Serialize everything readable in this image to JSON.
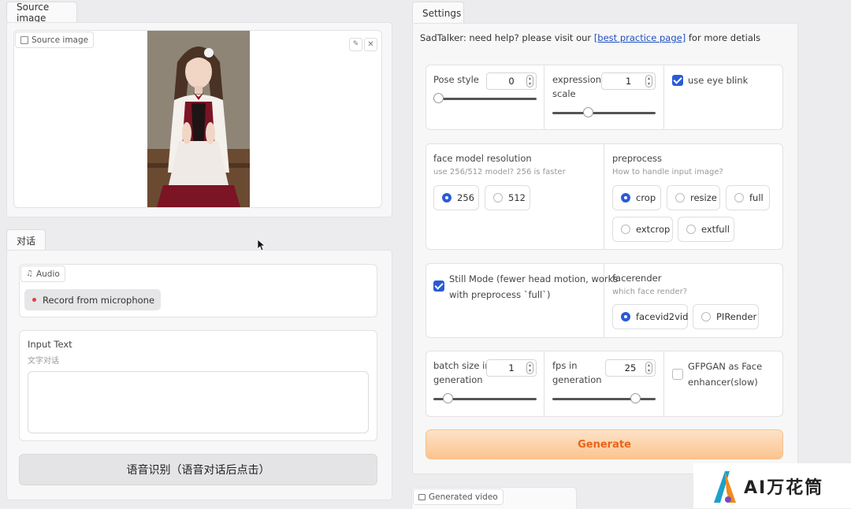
{
  "left": {
    "source_tab": "Source image",
    "source_chip": "Source image",
    "dialog_tab": "对话",
    "audio_chip": "Audio",
    "record_label": "Record from microphone",
    "input_label": "Input Text",
    "input_hint": "文字对话",
    "input_value": "",
    "recognize_button": "语音识别（语音对话后点击）"
  },
  "settings": {
    "tab": "Settings",
    "help_prefix": "SadTalker: need help? please visit our ",
    "help_link": "[best practice page]",
    "help_suffix": " for more detials",
    "pose_style": {
      "label": "Pose style",
      "value": "0",
      "slider_fraction": 0.02
    },
    "expression_scale": {
      "label_line1": "expression",
      "label_line2": "scale",
      "value": "1",
      "slider_fraction": 0.35
    },
    "eye_blink": {
      "label": "use eye blink",
      "checked": true
    },
    "face_res": {
      "label": "face model resolution",
      "hint": "use 256/512 model? 256 is faster",
      "options": [
        "256",
        "512"
      ],
      "selected": "256"
    },
    "preprocess": {
      "label": "preprocess",
      "hint": "How to handle input image?",
      "options": [
        "crop",
        "resize",
        "full",
        "extcrop",
        "extfull"
      ],
      "selected": "crop"
    },
    "still_mode": {
      "line1": "Still Mode (fewer head motion, works",
      "line2": "with preprocess `full`)",
      "checked": true
    },
    "facerender": {
      "label": "facerender",
      "hint": "which face render?",
      "options": [
        "facevid2vid",
        "PIRender"
      ],
      "selected": "facevid2vid"
    },
    "batch_size": {
      "line1": "batch size in",
      "line2": "generation",
      "value": "1",
      "slider_fraction": 0.1
    },
    "fps": {
      "line1": "fps in",
      "line2": "generation",
      "value": "25",
      "slider_fraction": 0.8
    },
    "gfpgan": {
      "line1": "GFPGAN as Face",
      "line2": "enhancer(slow)",
      "checked": false
    },
    "generate_button": "Generate"
  },
  "generated_video_chip": "Generated video",
  "watermark": {
    "text": "AI万花筒"
  },
  "colors": {
    "accent_blue": "#2a5bd7",
    "generate_orange": "#f07a24",
    "link_blue": "#1f4fbf"
  }
}
